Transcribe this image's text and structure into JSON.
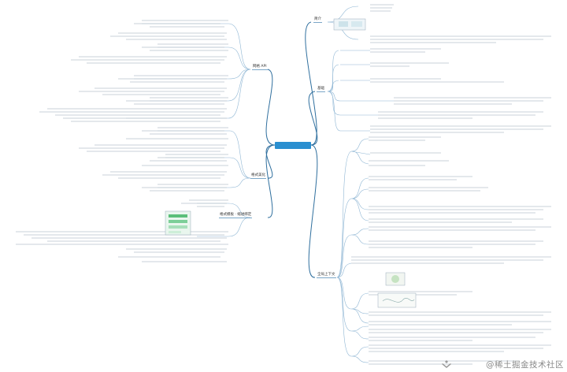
{
  "mindmap": {
    "center": {
      "label": ""
    },
    "branches_right": [
      {
        "id": "r1",
        "label": "简介"
      },
      {
        "id": "r2",
        "label": "基础"
      },
      {
        "id": "r3",
        "label": "全局上下文"
      }
    ],
    "branches_left": [
      {
        "id": "l1",
        "label": "网格 API"
      },
      {
        "id": "l2",
        "label": "格式美化"
      },
      {
        "id": "l3",
        "label": "格式模板 · 缩进绑定"
      }
    ]
  },
  "watermark": {
    "text": "@稀土掘金技术社区"
  },
  "colors": {
    "line": "#2f6f9e",
    "thin_line": "#8fb6d4",
    "center": "#2a8fd0",
    "text": "#333333",
    "watermark": "#8a8a8a"
  }
}
